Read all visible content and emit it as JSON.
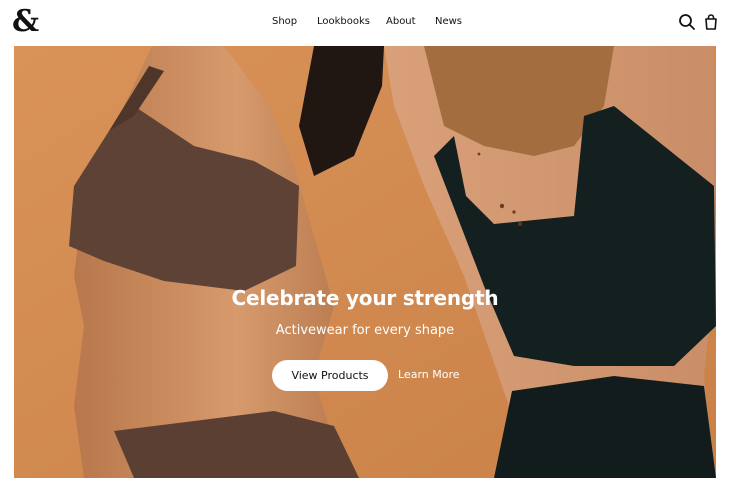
{
  "brand": {
    "logo_glyph": "&"
  },
  "nav": {
    "items": [
      {
        "label": "Shop"
      },
      {
        "label": "Lookbooks"
      },
      {
        "label": "About"
      },
      {
        "label": "News"
      }
    ]
  },
  "icons": {
    "search": "search-icon",
    "cart": "shopping-bag-icon"
  },
  "hero": {
    "title": "Celebrate your strength",
    "subtitle": "Activewear for every shape",
    "primary_cta": "View Products",
    "secondary_cta": "Learn More"
  },
  "colors": {
    "background": "#d28a4f",
    "brown_top": "#5e4235",
    "black_top": "#14201f",
    "text": "#111111",
    "white": "#ffffff"
  }
}
